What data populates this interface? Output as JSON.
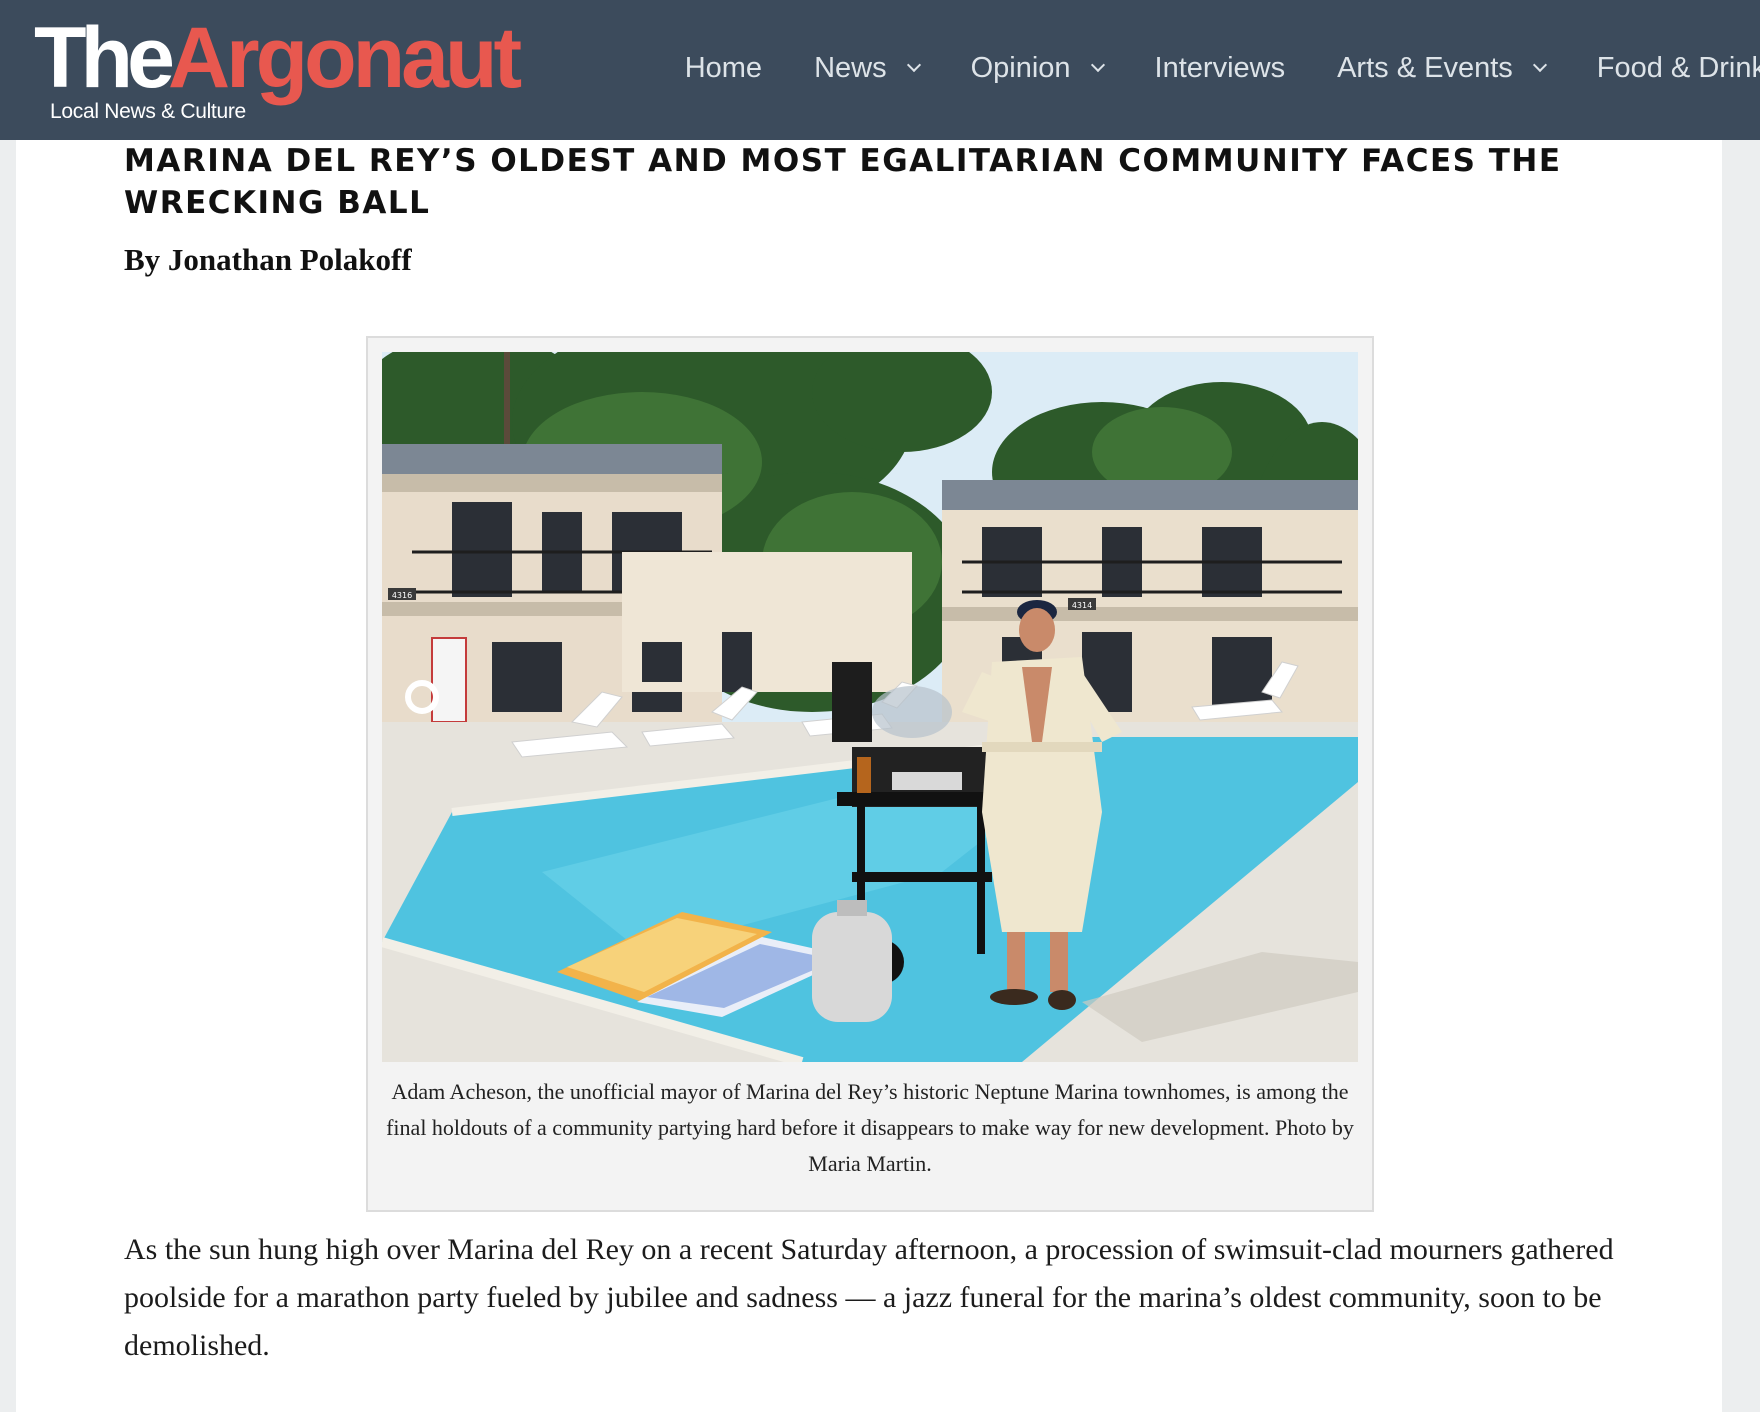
{
  "header": {
    "logo": {
      "the": "The",
      "argonaut": "Argonaut",
      "tagline": "Local News & Culture"
    },
    "nav": [
      {
        "label": "Home",
        "dropdown": false
      },
      {
        "label": "News",
        "dropdown": true
      },
      {
        "label": "Opinion",
        "dropdown": true
      },
      {
        "label": "Interviews",
        "dropdown": false
      },
      {
        "label": "Arts & Events",
        "dropdown": true
      },
      {
        "label": "Food & Drink",
        "dropdown": false
      }
    ]
  },
  "article": {
    "headline": "MARINA DEL REY’S OLDEST AND MOST EGALITARIAN COMMUNITY FACES THE WRECKING BALL",
    "byline": "By Jonathan Polakoff",
    "figure": {
      "caption": "Adam Acheson, the unofficial mayor of Marina del Rey’s historic Neptune Marina townhomes, is among the final holdouts of a community partying hard before it disappears to make way for new development. Photo by Maria Martin.",
      "photo_signs": {
        "unit_left": "4316",
        "unit_right": "4314"
      }
    },
    "body": "As the sun hung high over Marina del Rey on a recent Saturday afternoon, a procession of swimsuit-clad mourners gathered poolside for a marathon party fueled by jubilee and sadness — a jazz funeral for the marina’s oldest community, soon to be demolished."
  },
  "colors": {
    "header_bg": "#3c4b5c",
    "logo_accent": "#e8584f",
    "pool_water": "#4fc3e0",
    "sky": "#dcecf6"
  }
}
